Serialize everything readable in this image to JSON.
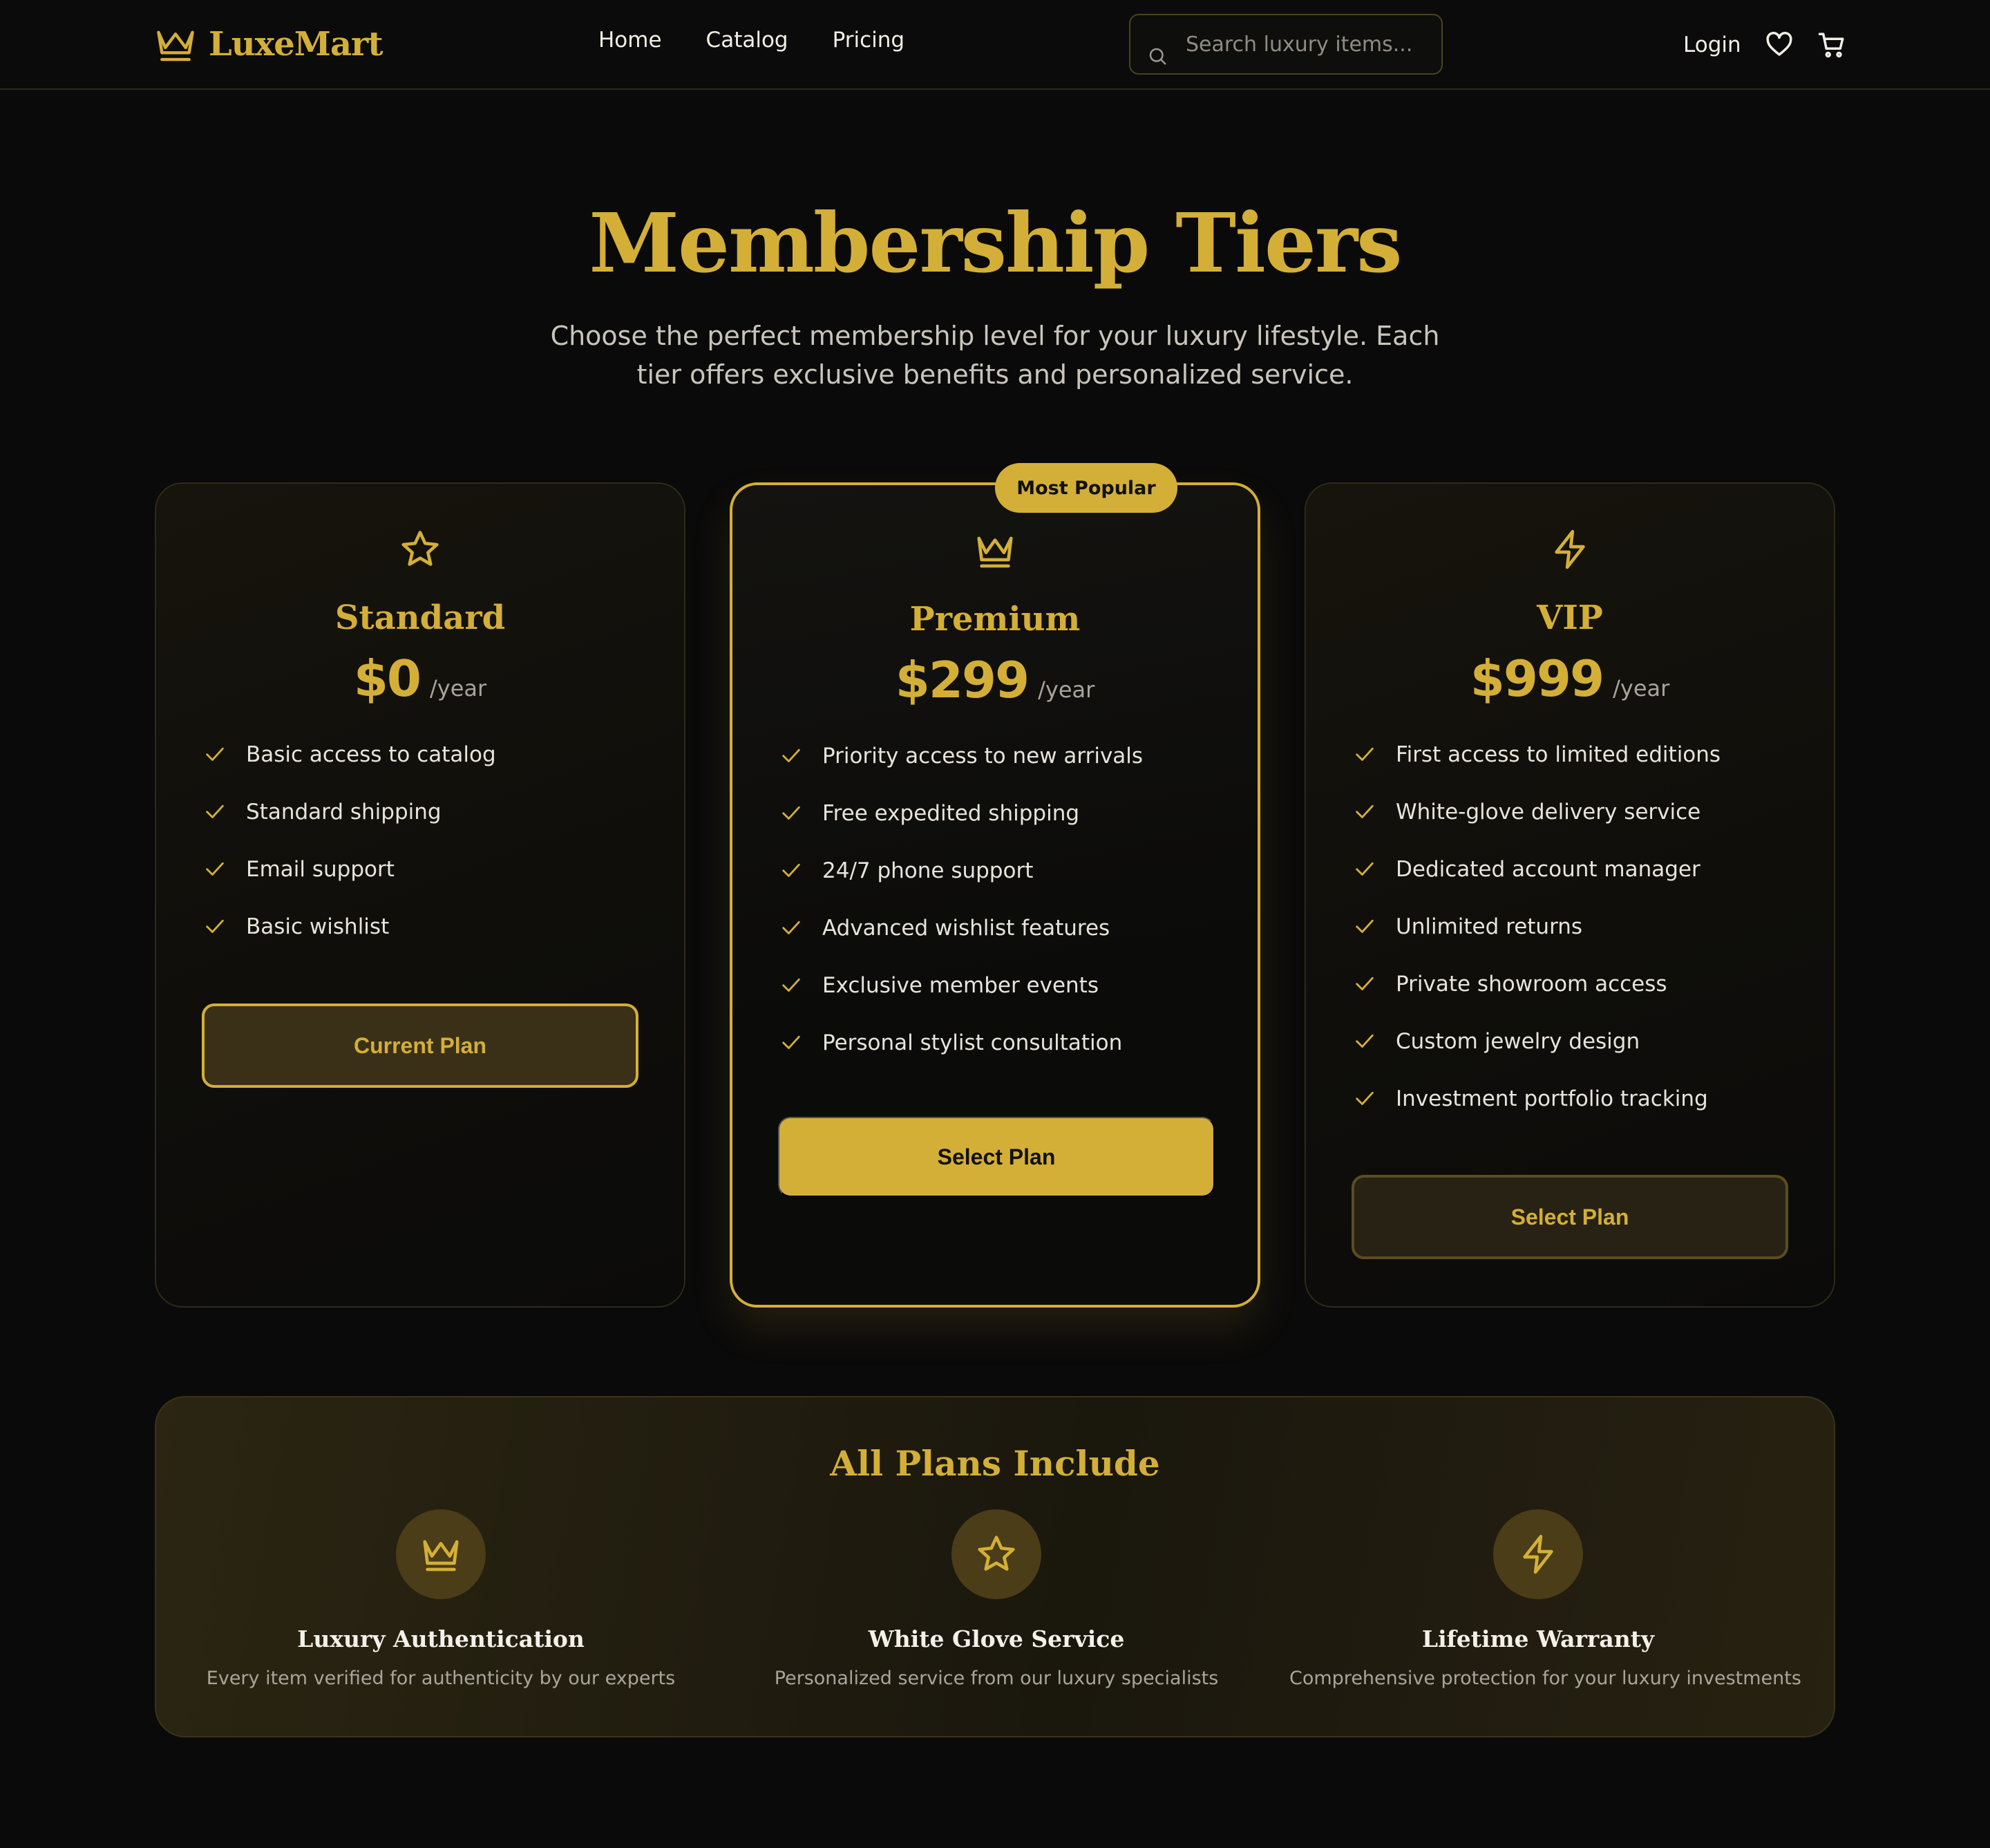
{
  "nav": {
    "brand": "LuxeMart",
    "links": [
      "Home",
      "Catalog",
      "Pricing"
    ],
    "search_placeholder": "Search luxury items...",
    "login": "Login"
  },
  "hero": {
    "title": "Membership Tiers",
    "subtitle": "Choose the perfect membership level for your luxury lifestyle. Each tier offers exclusive benefits and personalized service."
  },
  "tiers": [
    {
      "icon": "star-icon",
      "name": "Standard",
      "price": "$0",
      "period": "/year",
      "features": [
        "Basic access to catalog",
        "Standard shipping",
        "Email support",
        "Basic wishlist"
      ],
      "button": "Current Plan"
    },
    {
      "icon": "crown-icon",
      "badge": "Most Popular",
      "name": "Premium",
      "price": "$299",
      "period": "/year",
      "features": [
        "Priority access to new arrivals",
        "Free expedited shipping",
        "24/7 phone support",
        "Advanced wishlist features",
        "Exclusive member events",
        "Personal stylist consultation"
      ],
      "button": "Select Plan"
    },
    {
      "icon": "lightning-icon",
      "name": "VIP",
      "price": "$999",
      "period": "/year",
      "features": [
        "First access to limited editions",
        "White-glove delivery service",
        "Dedicated account manager",
        "Unlimited returns",
        "Private showroom access",
        "Custom jewelry design",
        "Investment portfolio tracking"
      ],
      "button": "Select Plan"
    }
  ],
  "includes": {
    "title": "All Plans Include",
    "items": [
      {
        "icon": "crown-icon",
        "name": "Luxury Authentication",
        "desc": "Every item verified for authenticity by our experts"
      },
      {
        "icon": "star-icon",
        "name": "White Glove Service",
        "desc": "Personalized service from our luxury specialists"
      },
      {
        "icon": "lightning-icon",
        "name": "Lifetime Warranty",
        "desc": "Comprehensive protection for your luxury investments"
      }
    ]
  },
  "colors": {
    "accent": "#d4af37",
    "background": "#0a0a0a"
  }
}
